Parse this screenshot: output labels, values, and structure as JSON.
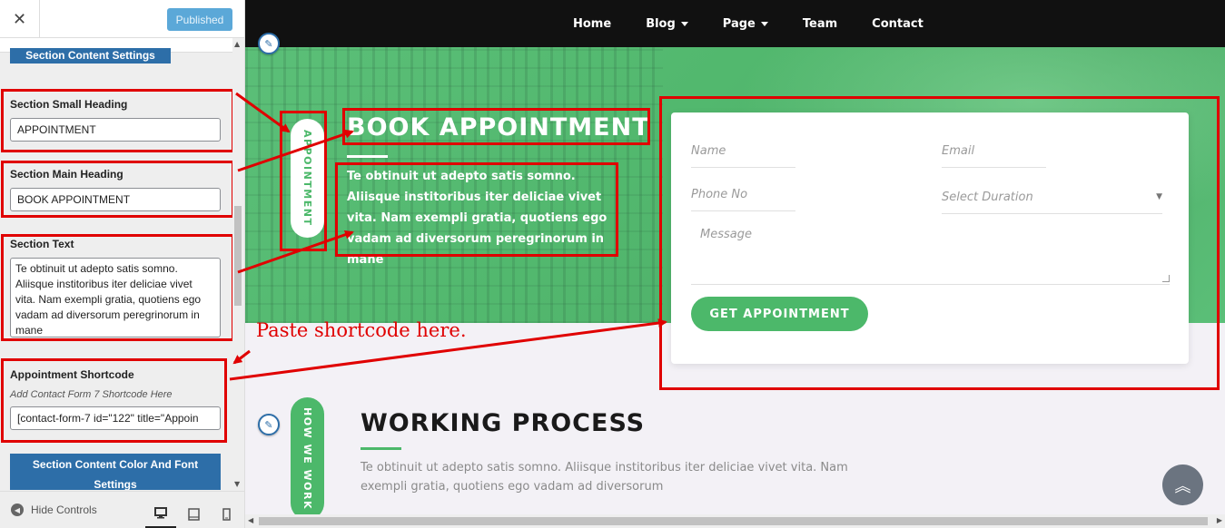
{
  "sidebar": {
    "close_icon": "close-icon",
    "published_label": "Published",
    "section_content_settings": "Section Content Settings",
    "small_heading": {
      "label": "Section Small Heading",
      "value": "APPOINTMENT"
    },
    "main_heading": {
      "label": "Section Main Heading",
      "value": "BOOK APPOINTMENT"
    },
    "section_text": {
      "label": "Section Text",
      "value": "Te obtinuit ut adepto satis somno. Aliisque institoribus iter deliciae vivet vita. Nam exempli gratia, quotiens ego vadam ad diversorum peregrinorum in mane"
    },
    "shortcode": {
      "label": "Appointment Shortcode",
      "description": "Add Contact Form 7 Shortcode Here",
      "value": "[contact-form-7 id=\"122\" title=\"Appoin"
    },
    "color_font_settings": "Section Content Color And Font Settings",
    "hide_controls": "Hide Controls"
  },
  "nav": {
    "items": [
      {
        "label": "Home",
        "dropdown": false
      },
      {
        "label": "Blog",
        "dropdown": true
      },
      {
        "label": "Page",
        "dropdown": true
      },
      {
        "label": "Team",
        "dropdown": false
      },
      {
        "label": "Contact",
        "dropdown": false
      }
    ]
  },
  "appointment": {
    "small_heading": "APPOINTMENT",
    "title": "BOOK APPOINTMENT",
    "text": "Te obtinuit ut adepto satis somno. Aliisque institoribus iter deliciae vivet vita. Nam exempli gratia, quotiens ego vadam ad diversorum peregrinorum in mane",
    "form": {
      "name_placeholder": "Name",
      "email_placeholder": "Email",
      "phone_placeholder": "Phone No",
      "duration_placeholder": "Select Duration",
      "message_placeholder": "Message",
      "submit_label": "GET APPOINTMENT"
    }
  },
  "working_process": {
    "small_heading": "HOW WE WORK",
    "title": "WORKING PROCESS",
    "text": "Te obtinuit ut adepto satis somno. Aliisque institoribus iter deliciae vivet vita. Nam exempli gratia, quotiens ego vadam ad diversorum"
  },
  "annotation": {
    "text": "Paste shortcode here."
  },
  "colors": {
    "accent_green": "#4cb86a",
    "annotation_red": "#e00000",
    "customizer_blue": "#2d6ea8"
  }
}
